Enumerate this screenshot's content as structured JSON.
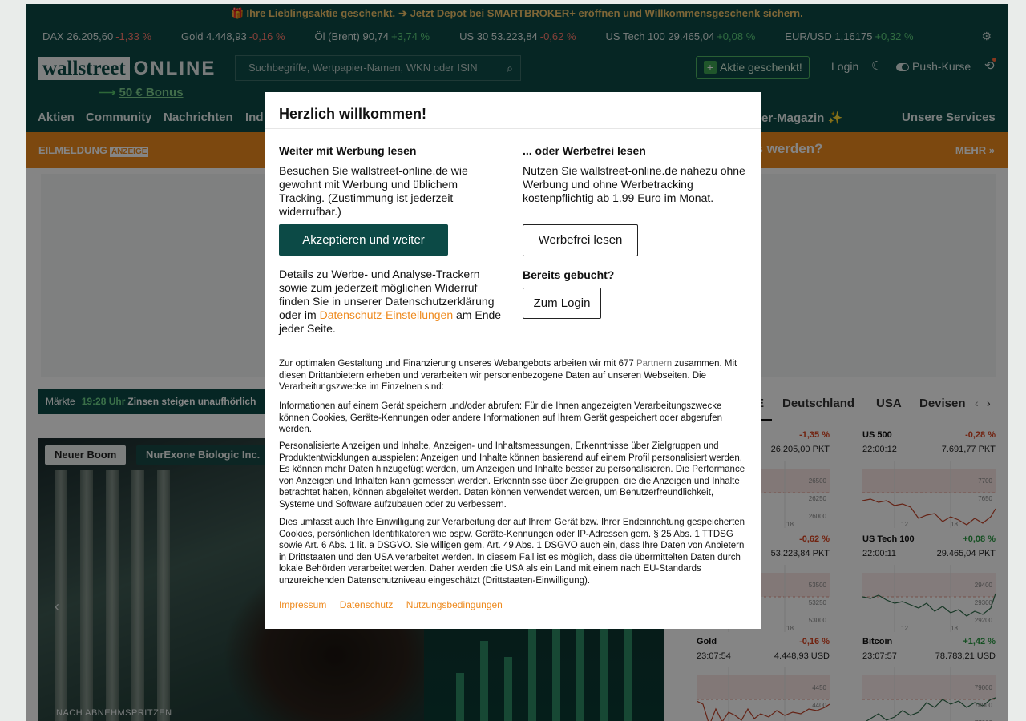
{
  "promo": {
    "text": "Ihre Lieblingsaktie geschenkt.",
    "link": "Jetzt Depot bei SMARTBROKER+ eröffnen und Willkommensgeschenk sichern."
  },
  "ticker": [
    {
      "name": "DAX",
      "value": "26.205,60",
      "change": "-1,33 %",
      "dir": "neg"
    },
    {
      "name": "Gold",
      "value": "4.448,93",
      "change": "-0,16 %",
      "dir": "neg"
    },
    {
      "name": "Öl (Brent)",
      "value": "90,74",
      "change": "+3,74 %",
      "dir": "pos"
    },
    {
      "name": "US 30",
      "value": "53.223,84",
      "change": "-0,62 %",
      "dir": "neg"
    },
    {
      "name": "US Tech 100",
      "value": "29.465,04",
      "change": "+0,08 %",
      "dir": "pos"
    },
    {
      "name": "EUR/USD",
      "value": "1,16175",
      "change": "+0,32 %",
      "dir": "pos"
    }
  ],
  "header": {
    "logo_left": "wallstreet",
    "logo_right": "ONLINE",
    "bonus": "50 € Bonus",
    "search_placeholder": "Suchbegriffe, Wertpapier-Namen, WKN oder ISIN",
    "gift_button": "Aktie geschenkt!",
    "login": "Login",
    "push": "Push-Kurse"
  },
  "nav": {
    "items": [
      "Aktien",
      "Community",
      "Nachrichten",
      "Ind"
    ],
    "magazine": "er-Magazin ✨",
    "services": "Unsere Services"
  },
  "orange_bar": {
    "label": "EILMELDUNG",
    "ad": "ANZEIGE",
    "headline": "es werden?",
    "more": "MEHR »"
  },
  "markets": {
    "label": "Märkte",
    "time": "19:28 Uhr",
    "text": "Zinsen steigen unaufhörlich"
  },
  "tabs": [
    "E",
    "Deutschland",
    "USA",
    "Devisen"
  ],
  "hero": {
    "tag1": "Neuer Boom",
    "tag2": "NurExone Biologic Inc.",
    "caption": "NACH ABNEHMSPRITZEN"
  },
  "mini_charts": [
    {
      "name": "",
      "time": "",
      "value": "26.205,00 PKT",
      "change": "-1,35 %",
      "dir": "neg",
      "ylabels": [
        "26500",
        "26250",
        "26000"
      ],
      "xlabels": [
        "18"
      ]
    },
    {
      "name": "US 500",
      "time": "22:00:12",
      "value": "7.691,77 PKT",
      "change": "-0,28 %",
      "dir": "neg",
      "ylabels": [
        "7700",
        "7650"
      ],
      "xlabels": [
        "12",
        "18"
      ]
    },
    {
      "name": "",
      "time": "",
      "value": "53.223,84 PKT",
      "change": "-0,62 %",
      "dir": "neg",
      "ylabels": [
        "53500",
        "53250",
        "53000"
      ],
      "xlabels": [
        "18"
      ]
    },
    {
      "name": "US Tech 100",
      "time": "22:00:11",
      "value": "29.465,04 PKT",
      "change": "+0,08 %",
      "dir": "pos",
      "ylabels": [
        "29400",
        "29300",
        "29200"
      ],
      "xlabels": [
        "12",
        "18"
      ]
    },
    {
      "name": "Gold",
      "time": "23:07:54",
      "value": "4.448,93 USD",
      "change": "-0,16 %",
      "dir": "neg",
      "ylabels": [
        "4450",
        "4400"
      ],
      "xlabels": []
    },
    {
      "name": "Bitcoin",
      "time": "23:07:57",
      "value": "78.783,21 USD",
      "change": "+1,42 %",
      "dir": "pos",
      "ylabels": [
        "79000",
        "78000",
        "77000"
      ],
      "xlabels": []
    }
  ],
  "modal": {
    "title": "Herzlich willkommen!",
    "left_head": "Weiter mit Werbung lesen",
    "left_text": "Besuchen Sie wallstreet-online.de wie gewohnt mit Werbung und üblichem Tracking. (Zustimmung ist jederzeit widerrufbar.)",
    "accept_button": "Akzeptieren und weiter",
    "details_before": "Details zu Werbe- und Analyse-Trackern sowie zum jederzeit möglichen Widerruf finden Sie in unserer Datenschutzerklärung oder im ",
    "details_link": "Datenschutz-Einstellungen",
    "details_after": " am Ende jeder Seite.",
    "right_head": "... oder Werbefrei lesen",
    "right_text": "Nutzen Sie wallstreet-online.de nahezu ohne Werbung und ohne Werbetracking kostenpflichtig ab 1.99 Euro im Monat.",
    "adfree_button": "Werbefrei lesen",
    "booked_head": "Bereits gebucht?",
    "login_button": "Zum Login",
    "p1_before": "Zur optimalen Gestaltung und Finanzierung unseres Webangebots arbeiten wir mit 677 ",
    "p1_link": "Partnern",
    "p1_after": " zusammen. Mit diesen Drittanbietern erheben und verarbeiten wir personenbezogene Daten auf unseren Webseiten. Die Verarbeitungszwecke im Einzelnen sind:",
    "p2": "Informationen auf einem Gerät speichern und/oder abrufen: Für die Ihnen angezeigten Verarbeitungszwecke können Cookies, Geräte-Kennungen oder andere Informationen auf Ihrem Gerät gespeichert oder abgerufen werden.",
    "p3": "Personalisierte Anzeigen und Inhalte, Anzeigen- und Inhaltsmessungen, Erkenntnisse über Zielgruppen und Produktentwicklungen ausspielen: Anzeigen und Inhalte können basierend auf einem Profil personalisiert werden. Es können mehr Daten hinzugefügt werden, um Anzeigen und Inhalte besser zu personalisieren. Die Performance von Anzeigen und Inhalten kann gemessen werden. Erkenntnisse über Zielgruppen, die die Anzeigen und Inhalte betrachtet haben, können abgeleitet werden. Daten können verwendet werden, um Benutzerfreundlichkeit, Systeme und Software aufzubauen oder zu verbessern.",
    "p4": "Dies umfasst auch Ihre Einwilligung zur Verarbeitung der auf Ihrem Gerät bzw. Ihrer Endeinrichtung gespeicherten Cookies, persönlichen Identifikatoren wie bspw. Geräte-Kennungen oder IP-Adressen gem. § 25 Abs. 1 TTDSG sowie Art. 6 Abs. 1 lit. a DSGVO. Sie willigen gem. Art. 49 Abs. 1 DSGVO auch ein, dass Ihre Daten von Anbietern in Drittstaaten und den USA verarbeitet werden. In diesem Fall ist es möglich, dass die übermittelten Daten durch lokale Behörden verarbeitet werden. Daher werden die USA als ein Land mit einem nach EU-Standards unzureichenden Datenschutzniveau eingeschätzt (Drittstaaten-Einwilligung).",
    "footer": [
      "Impressum",
      "Datenschutz",
      "Nutzungsbedingungen"
    ]
  }
}
